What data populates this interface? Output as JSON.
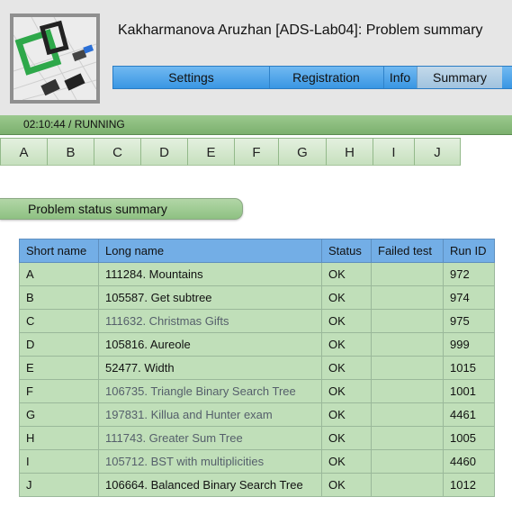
{
  "header": {
    "title": "Kakharmanova Aruzhan [ADS-Lab04]: Problem summary",
    "logo": "contest-logo-icon",
    "menu": [
      {
        "label": "Settings",
        "active": false
      },
      {
        "label": "Registration",
        "active": false
      },
      {
        "label": "Info",
        "active": false
      },
      {
        "label": "Summary",
        "active": true
      }
    ]
  },
  "status": {
    "text": "02:10:44 / RUNNING"
  },
  "problem_tabs": [
    "A",
    "B",
    "C",
    "D",
    "E",
    "F",
    "G",
    "H",
    "I",
    "J"
  ],
  "section": {
    "title": "Problem status summary"
  },
  "table": {
    "headers": [
      "Short name",
      "Long name",
      "Status",
      "Failed test",
      "Run ID"
    ],
    "rows": [
      {
        "short": "A",
        "long": "111284. Mountains",
        "status": "OK",
        "failed": "",
        "run": "972",
        "dim": false
      },
      {
        "short": "B",
        "long": "105587. Get subtree",
        "status": "OK",
        "failed": "",
        "run": "974",
        "dim": false
      },
      {
        "short": "C",
        "long": "111632. Christmas Gifts",
        "status": "OK",
        "failed": "",
        "run": "975",
        "dim": true
      },
      {
        "short": "D",
        "long": "105816. Aureole",
        "status": "OK",
        "failed": "",
        "run": "999",
        "dim": false
      },
      {
        "short": "E",
        "long": "52477. Width",
        "status": "OK",
        "failed": "",
        "run": "1015",
        "dim": false
      },
      {
        "short": "F",
        "long": "106735. Triangle Binary Search Tree",
        "status": "OK",
        "failed": "",
        "run": "1001",
        "dim": true
      },
      {
        "short": "G",
        "long": "197831. Killua and Hunter exam",
        "status": "OK",
        "failed": "",
        "run": "4461",
        "dim": true
      },
      {
        "short": "H",
        "long": "111743. Greater Sum Tree",
        "status": "OK",
        "failed": "",
        "run": "1005",
        "dim": true
      },
      {
        "short": "I",
        "long": "105712. BST with multiplicities",
        "status": "OK",
        "failed": "",
        "run": "4460",
        "dim": true
      },
      {
        "short": "J",
        "long": "106664. Balanced Binary Search Tree",
        "status": "OK",
        "failed": "",
        "run": "1012",
        "dim": false
      }
    ]
  }
}
